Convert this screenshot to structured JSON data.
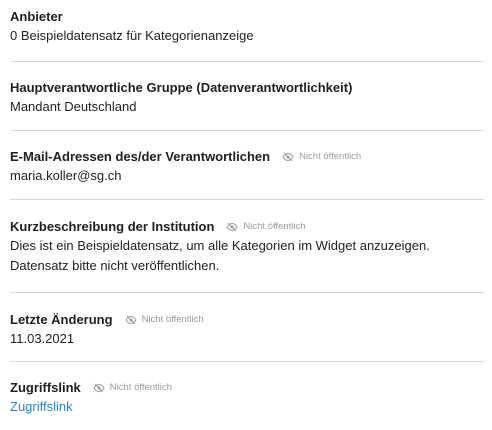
{
  "private_note": "Nicht öffentlich",
  "fields": {
    "provider": {
      "label": "Anbieter",
      "value": "0 Beispieldatensatz für Kategorienanzeige"
    },
    "main_group": {
      "label": "Hauptverantwortliche Gruppe (Datenverantwortlichkeit)",
      "value": "Mandant Deutschland"
    },
    "emails": {
      "label": "E-Mail-Adressen des/der Verantwortlichen",
      "value": "maria.koller@sg.ch",
      "icon": "eye-slash-icon"
    },
    "short_description": {
      "label": "Kurzbeschreibung der Institution",
      "value": "Dies ist ein Beispieldatensatz, um alle Kategorien im Widget anzuzeigen. Datensatz bitte nicht veröffentlichen.",
      "icon": "eye-slash-icon"
    },
    "last_change": {
      "label": "Letzte Änderung",
      "value": "11.03.2021",
      "icon": "eye-slash-icon"
    },
    "access_link": {
      "label": "Zugriffslink",
      "value": "Zugriffslink",
      "icon": "eye-slash-icon"
    }
  },
  "colors": {
    "link": "#2a86d1",
    "muted": "#9a9a9a",
    "divider": "#d9d9d9"
  }
}
